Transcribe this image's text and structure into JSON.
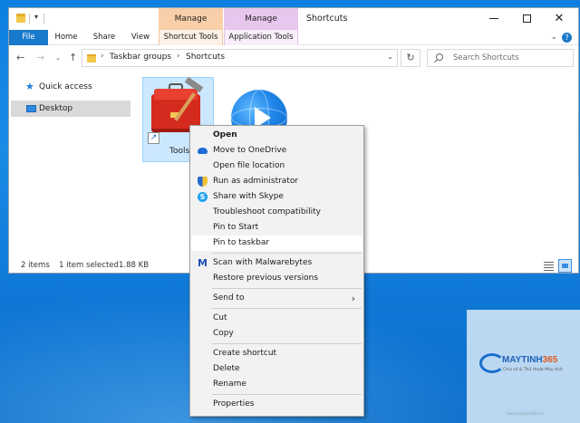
{
  "titlebar": {
    "title": "Shortcuts",
    "ctx_manage_1": "Manage",
    "ctx_manage_2": "Manage"
  },
  "ribbon": {
    "tabs": {
      "file": "File",
      "home": "Home",
      "share": "Share",
      "view": "View",
      "shortcut_tools": "Shortcut Tools",
      "application_tools": "Application Tools"
    },
    "help_glyph": "?"
  },
  "address": {
    "crumbs": [
      "Taskbar groups",
      "Shortcuts"
    ]
  },
  "search": {
    "placeholder": "Search Shortcuts"
  },
  "navpane": {
    "items": [
      "Quick access",
      "Desktop"
    ]
  },
  "files": [
    {
      "name": "Tools",
      "icon": "toolbox-icon",
      "selected": true
    },
    {
      "name": "",
      "icon": "internet-explorer-icon",
      "selected": false
    }
  ],
  "status": {
    "count": "2 items",
    "selected": "1 item selected",
    "size": "1.88 KB"
  },
  "context_menu": {
    "items": [
      {
        "label": "Open",
        "bold": true
      },
      {
        "label": "Move to OneDrive",
        "icon": "onedrive-icon"
      },
      {
        "label": "Open file location"
      },
      {
        "label": "Run as administrator",
        "icon": "uac-shield-icon"
      },
      {
        "label": "Share with Skype",
        "icon": "skype-icon"
      },
      {
        "label": "Troubleshoot compatibility"
      },
      {
        "label": "Pin to Start"
      },
      {
        "label": "Pin to taskbar",
        "highlighted": true
      },
      {
        "label": "Scan with Malwarebytes",
        "icon": "malwarebytes-icon"
      },
      {
        "label": "Restore previous versions"
      },
      {
        "label": "Send to",
        "submenu": true
      },
      {
        "label": "Cut"
      },
      {
        "label": "Copy"
      },
      {
        "label": "Create shortcut"
      },
      {
        "label": "Delete"
      },
      {
        "label": "Rename"
      },
      {
        "label": "Properties"
      }
    ]
  },
  "watermark": {
    "brand_main": "MAYTINH",
    "brand_num": "365",
    "tagline": "Chia sẻ & Thủ thuật Máy tính",
    "url": "www.maytinh365.vn"
  },
  "colors": {
    "accent": "#1979ca",
    "selection": "#cce8ff",
    "manage_orange": "#f9cfa9",
    "manage_purple": "#e8c7ee"
  }
}
